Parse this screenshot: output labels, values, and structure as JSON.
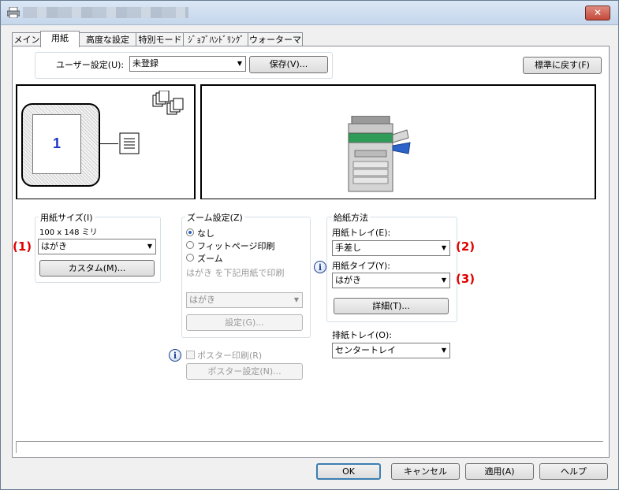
{
  "window": {
    "close_glyph": "✕"
  },
  "tabs": [
    "メイン",
    "用紙",
    "高度な設定",
    "特別モード",
    "ｼﾞｮﾌﾞﾊﾝﾄﾞﾘﾝｸﾞ",
    "ウォーターマーク"
  ],
  "active_tab": "用紙",
  "user_setting": {
    "label": "ユーザー設定(U):",
    "value": "未登録",
    "save": "保存(V)...",
    "reset": "標準に戻す(F)"
  },
  "preview": {
    "page_number": "1"
  },
  "paper_size": {
    "group": "用紙サイズ(I)",
    "dimensions": "100 x 148 ミリ",
    "value": "はがき",
    "custom": "カスタム(M)...",
    "marker": "(1)"
  },
  "zoom": {
    "group": "ズーム設定(Z)",
    "options": [
      "なし",
      "フィットページ印刷",
      "ズーム"
    ],
    "selected": "なし",
    "note": "はがき を下記用紙で印刷",
    "target": "はがき",
    "settings": "設定(G)..."
  },
  "poster": {
    "checkbox": "ポスター印刷(R)",
    "settings": "ポスター設定(N)..."
  },
  "feed": {
    "group": "給紙方法",
    "tray_label": "用紙トレイ(E):",
    "tray": "手差し",
    "tray_marker": "(2)",
    "type_label": "用紙タイプ(Y):",
    "type": "はがき",
    "type_marker": "(3)",
    "details": "詳細(T)..."
  },
  "output": {
    "label": "排紙トレイ(O):",
    "value": "センタートレイ"
  },
  "footer": {
    "ok": "OK",
    "cancel": "キャンセル",
    "apply": "適用(A)",
    "help": "ヘルプ"
  },
  "colors": {
    "marker_red": "#e00000",
    "page_number_blue": "#1a35c8"
  }
}
